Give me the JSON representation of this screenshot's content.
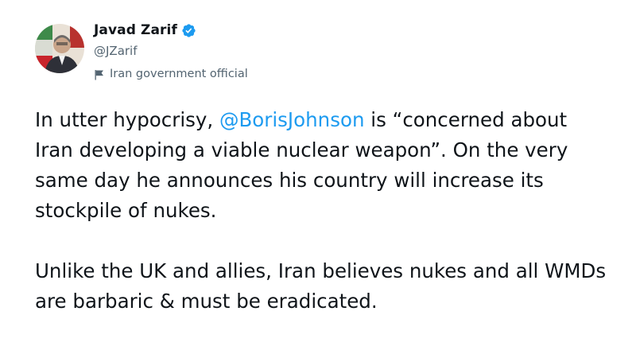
{
  "author": {
    "display_name": "Javad Zarif",
    "handle": "@JZarif",
    "account_label": "Iran government official",
    "verified": true,
    "verified_color": "#1d9bf0",
    "avatar_icon": "profile-photo",
    "label_icon": "flag-icon"
  },
  "tweet": {
    "paragraph1": {
      "before": "In utter hypocrisy, ",
      "mention": "@BorisJohnson",
      "after": " is “concerned about Iran developing a viable nuclear weapon”. On the very same day he announces his country will increase its stockpile of nukes."
    },
    "paragraph2": "Unlike the UK and allies, Iran believes nukes and all WMDs are barbaric & must be eradicated."
  },
  "colors": {
    "text": "#0f1419",
    "secondary": "#536471",
    "link": "#1d9bf0"
  }
}
